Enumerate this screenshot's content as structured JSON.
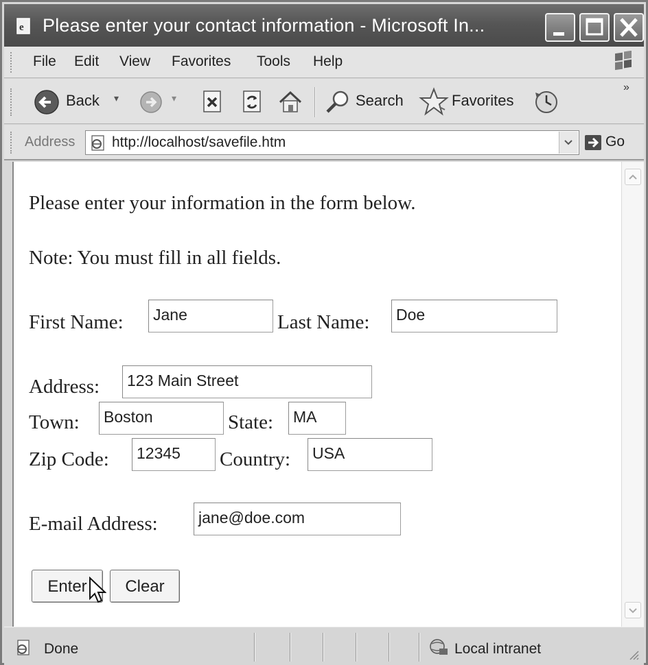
{
  "window": {
    "title": "Please enter your contact information - Microsoft In..."
  },
  "menu": {
    "items": [
      "File",
      "Edit",
      "View",
      "Favorites",
      "Tools",
      "Help"
    ]
  },
  "toolbar": {
    "back_label": "Back",
    "search_label": "Search",
    "favorites_label": "Favorites",
    "more": "»"
  },
  "address_bar": {
    "label": "Address",
    "url": "http://localhost/savefile.htm",
    "go_label": "Go"
  },
  "page": {
    "intro": "Please enter your information in the form below.",
    "note": "Note: You must fill in all fields.",
    "fields": {
      "first_name": {
        "label": "First Name:",
        "value": "Jane"
      },
      "last_name": {
        "label": "Last Name:",
        "value": "Doe"
      },
      "address": {
        "label": "Address:",
        "value": "123 Main Street"
      },
      "town": {
        "label": "Town:",
        "value": "Boston"
      },
      "state": {
        "label": "State:",
        "value": "MA"
      },
      "zip": {
        "label": "Zip Code:",
        "value": "12345"
      },
      "country": {
        "label": "Country:",
        "value": "USA"
      },
      "email": {
        "label": "E-mail Address:",
        "value": "jane@doe.com"
      }
    },
    "buttons": {
      "enter": "Enter",
      "clear": "Clear"
    }
  },
  "status_bar": {
    "status": "Done",
    "zone": "Local intranet"
  },
  "icons": {
    "app": "ie-page-icon",
    "back": "back-arrow-icon",
    "forward": "forward-arrow-icon",
    "stop": "stop-icon",
    "refresh": "refresh-icon",
    "home": "home-icon",
    "search": "magnifier-icon",
    "favorites": "star-icon",
    "history": "history-icon",
    "go": "go-arrow-icon",
    "zone": "intranet-icon"
  }
}
